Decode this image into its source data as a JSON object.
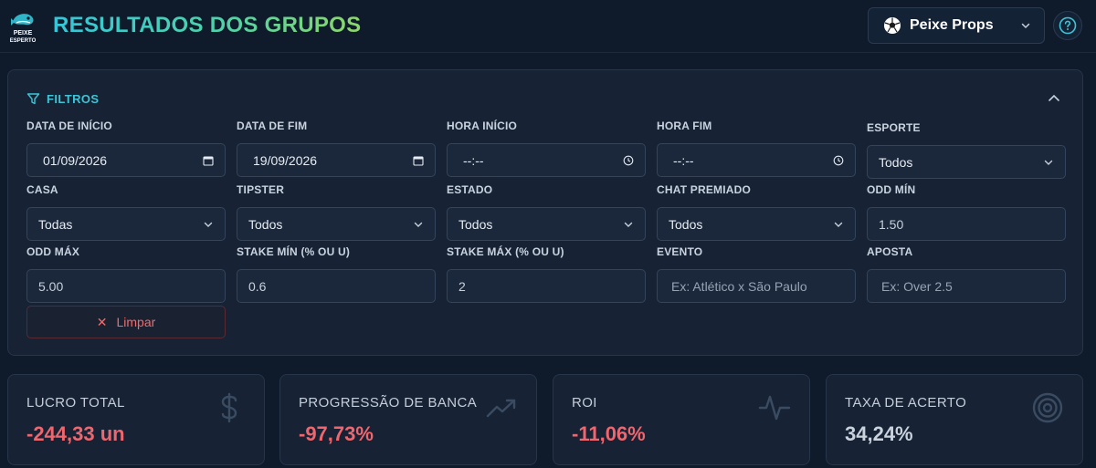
{
  "header": {
    "logo_text": "PEIXE ESPERTO",
    "title": "RESULTADOS DOS GRUPOS",
    "group_select": {
      "value": "Peixe Props",
      "icon": "soccer-ball-icon"
    },
    "help_icon": "help-circle-icon"
  },
  "filters": {
    "title": "FILTROS",
    "fields": {
      "data_inicio": {
        "label": "DATA DE INÍCIO",
        "value": "01/09/2026"
      },
      "data_fim": {
        "label": "DATA DE FIM",
        "value": "19/09/2026"
      },
      "hora_inicio": {
        "label": "HORA INÍCIO",
        "value": "--:--"
      },
      "hora_fim": {
        "label": "HORA FIM",
        "value": "--:--"
      },
      "esporte": {
        "label": "ESPORTE",
        "value": "Todos"
      },
      "casa": {
        "label": "CASA",
        "value": "Todas"
      },
      "tipster": {
        "label": "TIPSTER",
        "value": "Todos"
      },
      "estado": {
        "label": "ESTADO",
        "value": "Todos"
      },
      "chat_premiado": {
        "label": "CHAT PREMIADO",
        "value": "Todos"
      },
      "odd_min": {
        "label": "ODD MÍN",
        "value": "1.50"
      },
      "odd_max": {
        "label": "ODD MÁX",
        "value": "5.00"
      },
      "stake_min": {
        "label": "STAKE MÍN (% OU U)",
        "value": "0.6"
      },
      "stake_max": {
        "label": "STAKE MÁX (% OU U)",
        "value": "2"
      },
      "evento": {
        "label": "EVENTO",
        "placeholder": "Ex: Atlético x São Paulo"
      },
      "aposta": {
        "label": "APOSTA",
        "placeholder": "Ex: Over 2.5"
      }
    },
    "clear_label": "Limpar"
  },
  "stats": [
    {
      "title": "LUCRO TOTAL",
      "value": "-244,33 un",
      "icon": "dollar-icon",
      "color": "#f0666e"
    },
    {
      "title": "PROGRESSÃO DE BANCA",
      "value": "-97,73%",
      "icon": "trending-up-icon",
      "color": "#f0666e"
    },
    {
      "title": "ROI",
      "value": "-11,06%",
      "icon": "activity-icon",
      "color": "#f0666e"
    },
    {
      "title": "TAXA DE ACERTO",
      "value": "34,24%",
      "icon": "target-icon",
      "color": "#c9d2dd"
    }
  ],
  "colors": {
    "background": "#0f1a2b",
    "panel": "#172334",
    "accent": "#3ec4d6",
    "negative": "#f0666e"
  }
}
